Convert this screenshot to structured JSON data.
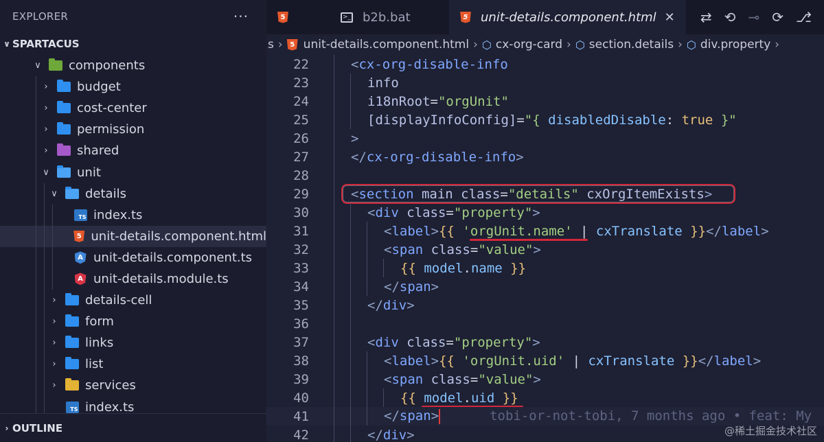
{
  "sidebar": {
    "title": "EXPLORER",
    "more": "···",
    "project": "SPARTACUS",
    "outline": "OUTLINE",
    "tree": [
      {
        "label": "components",
        "chev": "∨",
        "icon": "folder-green"
      },
      {
        "label": "budget",
        "chev": "›",
        "icon": "folder"
      },
      {
        "label": "cost-center",
        "chev": "›",
        "icon": "folder"
      },
      {
        "label": "permission",
        "chev": "›",
        "icon": "folder"
      },
      {
        "label": "shared",
        "chev": "›",
        "icon": "folder-purple"
      },
      {
        "label": "unit",
        "chev": "∨",
        "icon": "folder-open"
      },
      {
        "label": "details",
        "chev": "∨",
        "icon": "folder-open"
      },
      {
        "label": "index.ts",
        "chev": "",
        "icon": "ts-file",
        "badge": "TS"
      },
      {
        "label": "unit-details.component.html",
        "chev": "",
        "icon": "html-file",
        "badge": "5"
      },
      {
        "label": "unit-details.component.ts",
        "chev": "",
        "icon": "angular-ts-file",
        "badge": "A"
      },
      {
        "label": "unit-details.module.ts",
        "chev": "",
        "icon": "angular-module-file",
        "badge": "A"
      },
      {
        "label": "details-cell",
        "chev": "›",
        "icon": "folder"
      },
      {
        "label": "form",
        "chev": "›",
        "icon": "folder"
      },
      {
        "label": "links",
        "chev": "›",
        "icon": "folder"
      },
      {
        "label": "list",
        "chev": "›",
        "icon": "folder"
      },
      {
        "label": "services",
        "chev": "›",
        "icon": "folder-yellow"
      },
      {
        "label": "index.ts",
        "chev": "",
        "icon": "ts-file",
        "badge": "TS"
      }
    ]
  },
  "tabs": [
    {
      "label": "",
      "icon": "html-file",
      "badge": "5"
    },
    {
      "label": "b2b.bat",
      "icon": "terminal-icon",
      "badge": ">_"
    },
    {
      "label": "unit-details.component.html",
      "icon": "html-file",
      "badge": "5",
      "close": "✕"
    }
  ],
  "tab_actions": [
    "compare-changes-icon",
    "go-back-icon",
    "git-commit-icon",
    "go-forward-icon",
    "git-graph-icon"
  ],
  "breadcrumb": [
    "s",
    "unit-details.component.html",
    "cx-org-card",
    "section.details",
    "div.property"
  ],
  "code": {
    "numbers": [
      "22",
      "23",
      "24",
      "25",
      "26",
      "27",
      "28",
      "29",
      "30",
      "31",
      "32",
      "33",
      "34",
      "35",
      "36",
      "37",
      "38",
      "39",
      "40",
      "41",
      "42"
    ],
    "l22": {
      "open": "<",
      "tag": "cx-org-disable-info"
    },
    "l23": {
      "text": "info"
    },
    "l24": {
      "attr": "i18nRoot",
      "eq": "=",
      "val": "\"orgUnit\""
    },
    "l25": {
      "attr": "[displayInfoConfig]",
      "eq": "=",
      "q1": "\"{ ",
      "key": "disabledDisable",
      "colon": ": ",
      "kw": "true",
      "q2": " }\""
    },
    "l26": {
      "text": ">"
    },
    "l27": {
      "open": "</",
      "tag": "cx-org-disable-info",
      "close": ">"
    },
    "l29": {
      "open": "<",
      "tag": "section",
      "a1": " main ",
      "a2": "class",
      "eq": "=",
      "val": "\"details\"",
      "a3": " cxOrgItemExists",
      "close": ">"
    },
    "l30": {
      "open": "<",
      "tag": "div",
      "attr": " class",
      "eq": "=",
      "val": "\"property\"",
      "close": ">"
    },
    "l31": {
      "open": "<",
      "tag": "label",
      "close": ">",
      "b1": "{{ ",
      "str": "'orgUnit.name'",
      "pipe": " | ",
      "fn": "cxTranslate",
      "b2": " }}",
      "etag_open": "</",
      "etag": "label",
      "etag_close": ">"
    },
    "l32": {
      "open": "<",
      "tag": "span",
      "attr": " class",
      "eq": "=",
      "val": "\"value\"",
      "close": ">"
    },
    "l33": {
      "b1": "{{ ",
      "obj": "model",
      "dot": ".",
      "prop": "name",
      "b2": " }}"
    },
    "l34": {
      "open": "</",
      "tag": "span",
      "close": ">"
    },
    "l35": {
      "open": "</",
      "tag": "div",
      "close": ">"
    },
    "l37": {
      "open": "<",
      "tag": "div",
      "attr": " class",
      "eq": "=",
      "val": "\"property\"",
      "close": ">"
    },
    "l38": {
      "open": "<",
      "tag": "label",
      "close": ">",
      "b1": "{{ ",
      "str": "'orgUnit.uid'",
      "pipe": " | ",
      "fn": "cxTranslate",
      "b2": " }}",
      "etag_open": "</",
      "etag": "label",
      "etag_close": ">"
    },
    "l39": {
      "open": "<",
      "tag": "span",
      "attr": " class",
      "eq": "=",
      "val": "\"value\"",
      "close": ">"
    },
    "l40": {
      "b1": "{{ ",
      "obj": "model",
      "dot": ".",
      "prop": "uid",
      "b2": " }}"
    },
    "l41": {
      "open": "</",
      "tag": "span",
      "close": ">",
      "blame": "tobi-or-not-tobi, 7 months ago • feat: My"
    },
    "l42": {
      "open": "</",
      "tag": "div",
      "close": ">"
    }
  },
  "watermark": "@稀土掘金技术社区",
  "colors": {
    "highlight": "#d3283a",
    "tag": "#7fa8ff",
    "string": "#a3cf84"
  }
}
